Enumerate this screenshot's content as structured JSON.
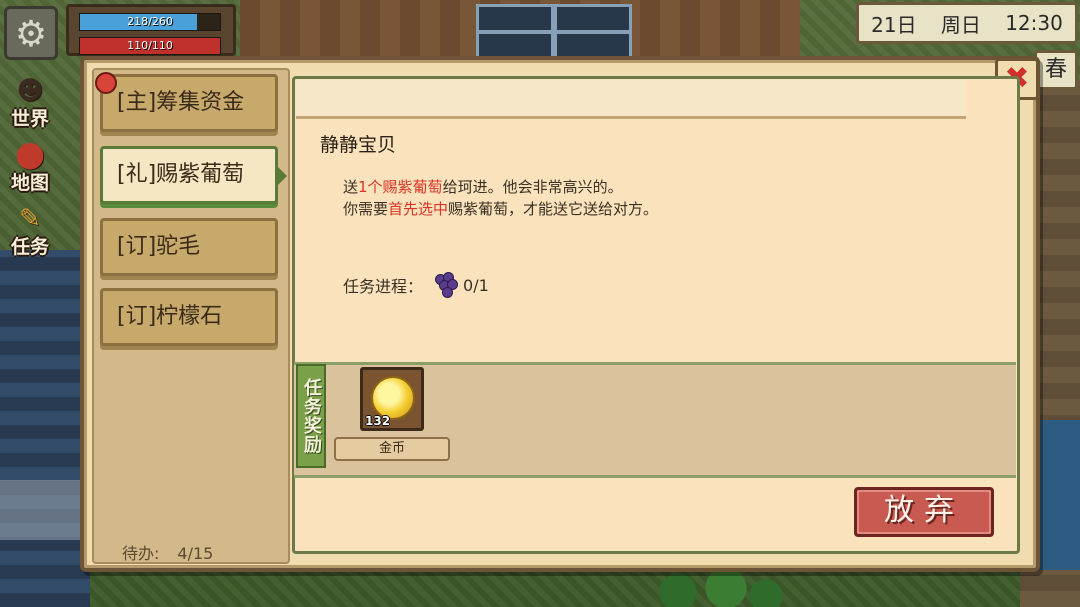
{
  "hud": {
    "settings_icon": "gear-icon",
    "energy": {
      "text": "218/260",
      "value": 218,
      "max": 260,
      "color": "#4aa0d8"
    },
    "health": {
      "text": "110/110",
      "value": 110,
      "max": 110,
      "color": "#c0302c"
    },
    "date": {
      "day": "21日",
      "weekday": "周日",
      "time": "12:30"
    },
    "season": "春"
  },
  "sidenav": [
    {
      "label": "世界",
      "icon": "people-icon"
    },
    {
      "label": "地图",
      "icon": "map-pin-icon"
    },
    {
      "label": "任务",
      "icon": "quest-icon"
    }
  ],
  "quest_list": {
    "tabs": [
      {
        "label": "[主]筹集资金",
        "active": false
      },
      {
        "label": "[礼]赐紫葡萄",
        "active": true
      },
      {
        "label": "[订]驼毛",
        "active": false
      },
      {
        "label": "[订]柠檬石",
        "active": false
      }
    ],
    "todo_label": "待办:",
    "todo_count": "4/15"
  },
  "quest_detail": {
    "npc_name": "静静宝贝",
    "line1": {
      "pre": "送",
      "highlight": "1个赐紫葡萄",
      "post": "给珂进。他会非常高兴的。"
    },
    "line2": {
      "pre": "你需要",
      "highlight": "首先选中",
      "post": "赐紫葡萄，才能送它送给对方。"
    },
    "progress_label": "任务进程：",
    "progress_icon": "grape-icon",
    "progress_value": "0/1"
  },
  "reward": {
    "section_label": "任务奖励",
    "item_icon": "gold-coin-icon",
    "quantity": "132",
    "name": "金币"
  },
  "buttons": {
    "abandon": "放弃",
    "close_icon": "close-icon"
  },
  "colors": {
    "highlight": "#d83428",
    "abandon_button": "#c85a52",
    "panel_bg": "#f1dcb0"
  }
}
